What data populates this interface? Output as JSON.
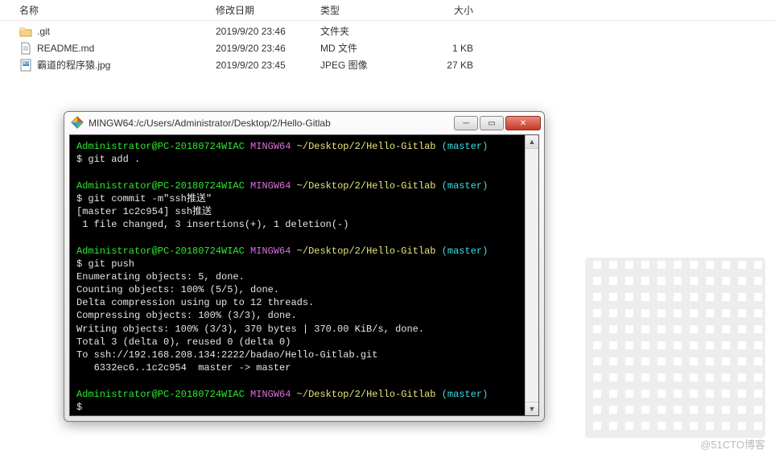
{
  "explorer": {
    "headers": {
      "name": "名称",
      "date": "修改日期",
      "type": "类型",
      "size": "大小"
    },
    "rows": [
      {
        "icon": "folder",
        "name": ".git",
        "date": "2019/9/20 23:46",
        "type": "文件夹",
        "size": ""
      },
      {
        "icon": "doc",
        "name": "README.md",
        "date": "2019/9/20 23:46",
        "type": "MD 文件",
        "size": "1 KB"
      },
      {
        "icon": "img",
        "name": "霸道的程序猿.jpg",
        "date": "2019/9/20 23:45",
        "type": "JPEG 图像",
        "size": "27 KB"
      }
    ]
  },
  "terminal": {
    "title": "MINGW64:/c/Users/Administrator/Desktop/2/Hello-Gitlab",
    "prompt": {
      "user": "Administrator@PC-20180724WIAC",
      "shell": "MINGW64",
      "path": "~/Desktop/2/Hello-Gitlab",
      "branch": "(master)"
    },
    "lines": {
      "l1": "$ git add .",
      "l2": "$ git commit -m\"ssh推送\"",
      "l3": "[master 1c2c954] ssh推送",
      "l4": " 1 file changed, 3 insertions(+), 1 deletion(-)",
      "l5": "$ git push",
      "l6": "Enumerating objects: 5, done.",
      "l7": "Counting objects: 100% (5/5), done.",
      "l8": "Delta compression using up to 12 threads.",
      "l9": "Compressing objects: 100% (3/3), done.",
      "l10": "Writing objects: 100% (3/3), 370 bytes | 370.00 KiB/s, done.",
      "l11": "Total 3 (delta 0), reused 0 (delta 0)",
      "l12": "To ssh://192.168.208.134:2222/badao/Hello-Gitlab.git",
      "l13": "   6332ec6..1c2c954  master -> master",
      "l14": "$"
    }
  },
  "watermark": "@51CTO博客"
}
